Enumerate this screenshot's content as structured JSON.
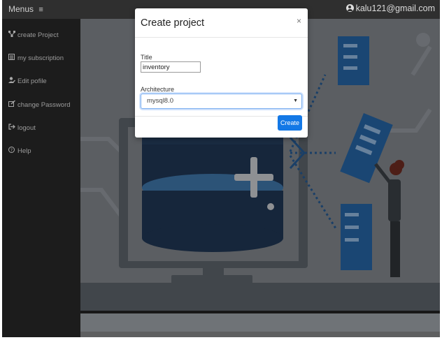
{
  "header": {
    "menu_label": "Menus",
    "menu_icon": "hamburger-icon",
    "user_email": "kalu121@gmail.com",
    "user_icon": "user-circle-icon"
  },
  "sidebar": {
    "items": [
      {
        "label": "create Project",
        "icon": "sitemap-icon"
      },
      {
        "label": "my subscription",
        "icon": "list-icon"
      },
      {
        "label": "Edit pofile",
        "icon": "user-edit-icon"
      },
      {
        "label": "change Password",
        "icon": "edit-icon"
      },
      {
        "label": "logout",
        "icon": "sign-out-icon"
      },
      {
        "label": "Help",
        "icon": "question-circle-icon"
      }
    ]
  },
  "modal": {
    "title": "Create project",
    "close_glyph": "×",
    "title_label": "Title",
    "title_value": "inventory",
    "architecture_label": "Architecture",
    "architecture_value": "mysql8.0",
    "create_label": "Create"
  },
  "colors": {
    "accent": "#1378e6",
    "topbar": "#2f2f2f",
    "sidebar": "#1c1c1c",
    "illustration_blue": "#1f4f7f"
  }
}
